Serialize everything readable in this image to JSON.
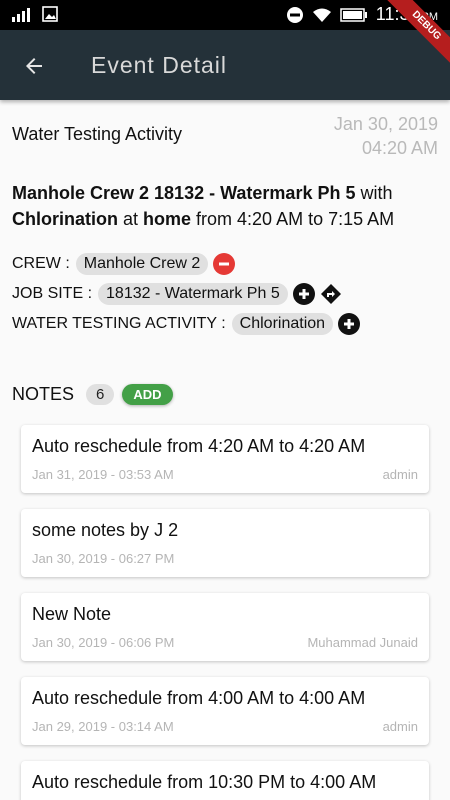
{
  "status_bar": {
    "time": "11:30",
    "ampm": "PM"
  },
  "app_bar": {
    "title": "Event Detail",
    "debug_label": "DEBUG"
  },
  "event": {
    "activity_title": "Water Testing Activity",
    "date": "Jan 30, 2019",
    "time": "04:20 AM",
    "summary": {
      "crew": "Manhole Crew 2 18132 - Watermark Ph 5",
      "with_word": " with ",
      "activity": "Chlorination",
      "at_word": " at ",
      "place": "home",
      "range": " from 4:20 AM to 7:15 AM"
    }
  },
  "fields": {
    "crew": {
      "label": "CREW :",
      "value": "Manhole Crew 2"
    },
    "job_site": {
      "label": "JOB SITE :",
      "value": "18132 - Watermark Ph 5"
    },
    "water_testing": {
      "label": "WATER TESTING ACTIVITY :",
      "value": "Chlorination"
    }
  },
  "notes": {
    "label": "NOTES",
    "count": "6",
    "add_label": "ADD",
    "items": [
      {
        "text": "Auto reschedule from 4:20 AM to 4:20 AM",
        "date": "Jan 31, 2019 - 03:53 AM",
        "author": "admin"
      },
      {
        "text": "some notes by J 2",
        "date": "Jan 30, 2019 - 06:27 PM",
        "author": ""
      },
      {
        "text": "New Note",
        "date": "Jan 30, 2019 - 06:06 PM",
        "author": "Muhammad Junaid"
      },
      {
        "text": "Auto reschedule from 4:00 AM to 4:00 AM",
        "date": "Jan 29, 2019 - 03:14 AM",
        "author": "admin"
      },
      {
        "text": "Auto reschedule from 10:30 PM to 4:00 AM",
        "date": "",
        "author": ""
      }
    ]
  },
  "colors": {
    "app_bar": "#243139",
    "remove": "#e53935",
    "add": "#43a047",
    "debug": "#b51e1e"
  }
}
